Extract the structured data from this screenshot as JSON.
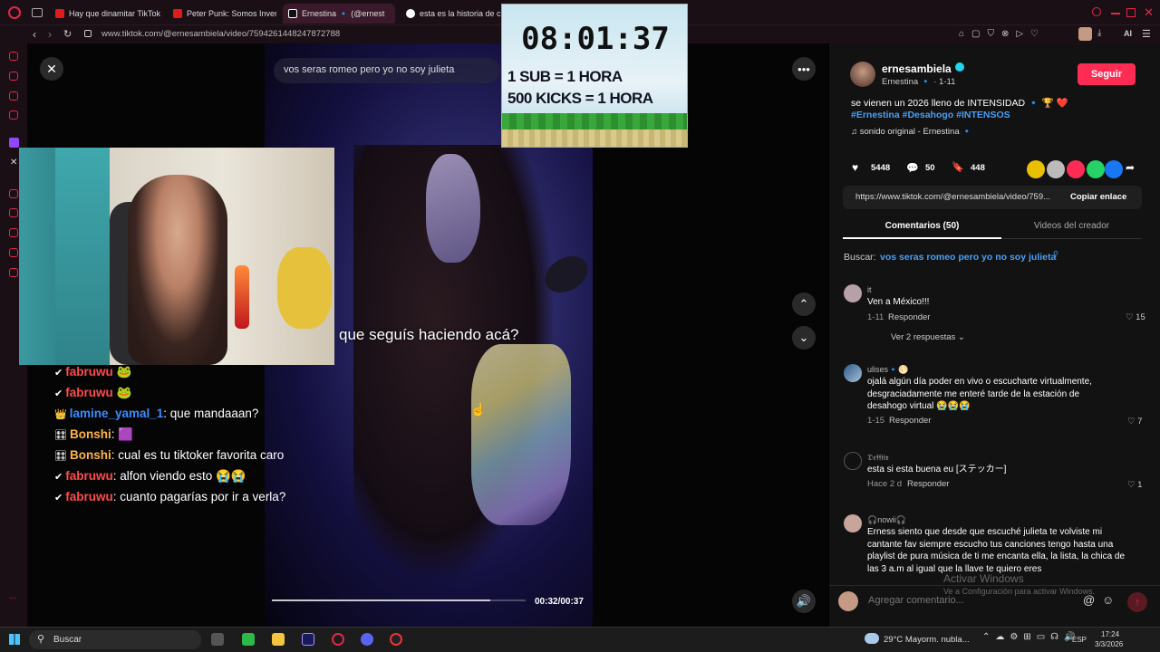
{
  "browser": {
    "tabs": [
      {
        "label": "Hay que dinamitar TikTok ,"
      },
      {
        "label": "Peter Punk: Somos Inven"
      },
      {
        "label": "Ernestina 🔹 (@ernest"
      },
      {
        "label": "esta es la historia de cam"
      }
    ],
    "url": "www.tiktok.com/@ernesambiela/video/7594261448247872788",
    "ai_label": "AI"
  },
  "video": {
    "search_query": "vos seras romeo pero yo no soy julieta",
    "subtitle": "que seguís haciendo acá?",
    "timecode": "00:32/00:37",
    "progress": 0.86
  },
  "overlay_timer": {
    "time": "08:01:37",
    "line1": "1 SUB = 1 HORA",
    "line2": "500 KICKS = 1 HORA"
  },
  "chat": [
    {
      "user": "fabruwu",
      "text": " 🐸",
      "color": "#ff4b4b",
      "badge": "✔"
    },
    {
      "user": "fabruwu",
      "text": " 🐸",
      "color": "#ff4b4b",
      "badge": "✔"
    },
    {
      "user": "lamine_yamal_1",
      "text": ": que mandaaan?",
      "color": "#3b8cff",
      "badge": "👑"
    },
    {
      "user": "Bonshi",
      "text": ": 🟪",
      "color": "#ffb347",
      "badge": "🎛"
    },
    {
      "user": "Bonshi",
      "text": ": cual es tu tiktoker favorita caro",
      "color": "#ffb347",
      "badge": "🎛"
    },
    {
      "user": "fabruwu",
      "text": ": alfon viendo esto 😭😭",
      "color": "#ff4b4b",
      "badge": "✔"
    },
    {
      "user": "fabruwu",
      "text": ": cuanto pagarías por ir a verla?",
      "color": "#ff4b4b",
      "badge": "✔"
    }
  ],
  "creator": {
    "username": "ernesambiela",
    "display": "Ernestina 🔹 · 1-11",
    "follow_label": "Seguir",
    "caption": "se vienen un 2026 lleno de INTENSIDAD 🔹 🏆 ❤️",
    "hashtags": "#Ernestina #Desahogo #INTENSOS",
    "sound": "♫  sonido original - Ernestina 🔹",
    "likes": "5448",
    "comments": "50",
    "saves": "448",
    "link": "https://www.tiktok.com/@ernesambiela/video/759...",
    "copy_label": "Copiar enlace"
  },
  "tabs": {
    "comments": "Comentarios (50)",
    "videos": "Videos del creador"
  },
  "search_line": {
    "prefix": "Buscar:",
    "query": "vos seras romeo pero yo no soy julieta"
  },
  "comments": [
    {
      "name": "it",
      "text": "Ven a México!!!",
      "date": "1-11",
      "reply": "Responder",
      "likes": "15",
      "more": "Ver 2 respuestas ⌄"
    },
    {
      "name": "ulises🔹🌕",
      "text": "ojalá algún día poder en vivo o escucharte virtualmente, desgraciadamente me enteré tarde de la estación de desahogo virtual 😭😭😭",
      "date": "1-15",
      "reply": "Responder",
      "likes": "7"
    },
    {
      "name": "𝔇𝔢𝔣𝔣𝔦𝔦𝔵",
      "text": "esta si esta buena eu [ステッカー]",
      "date": "Hace 2 d",
      "reply": "Responder",
      "likes": "1"
    },
    {
      "name": "🎧nowii🎧",
      "text": "Erness siento que desde que escuché julieta te volviste mi cantante fav siempre escucho tus canciones tengo hasta una playlist de pura música de ti me encanta ella, la lista, la chica de las 3 a.m al igual que la llave te quiero eres",
      "date": "",
      "reply": "",
      "likes": ""
    }
  ],
  "add_comment_placeholder": "Agregar comentario...",
  "watermark": {
    "line1": "Activar Windows",
    "line2": "Ve a Configuración para activar Windows."
  },
  "taskbar": {
    "search": "Buscar",
    "weather": "29°C  Mayorm. nubla...",
    "lang": "ESP",
    "time": "17:24",
    "date": "3/3/2026"
  }
}
